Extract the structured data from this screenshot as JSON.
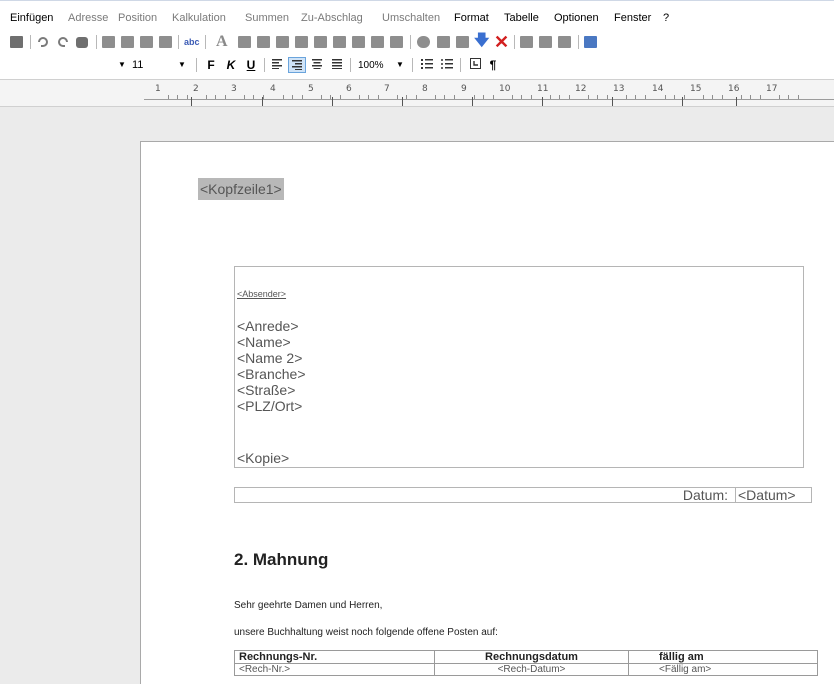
{
  "menu": [
    {
      "label": "Einfügen",
      "enabled": true
    },
    {
      "label": "Adresse",
      "enabled": false
    },
    {
      "label": "Position",
      "enabled": false
    },
    {
      "label": "Kalkulation",
      "enabled": false
    },
    {
      "label": "Summen",
      "enabled": false
    },
    {
      "label": "Zu-Abschlag",
      "enabled": false
    },
    {
      "label": "Umschalten",
      "enabled": false
    },
    {
      "label": "Format",
      "enabled": true
    },
    {
      "label": "Tabelle",
      "enabled": true
    },
    {
      "label": "Optionen",
      "enabled": true
    },
    {
      "label": "Fenster",
      "enabled": true
    },
    {
      "label": "?",
      "enabled": true
    }
  ],
  "toolbar": {
    "spell_check_label": "abc",
    "text_color_label": "A",
    "delete_label": "✕",
    "down_arrow_label": "🡇"
  },
  "format_bar": {
    "font_size": "11",
    "bold_label": "F",
    "italic_label": "K",
    "underline_label": "U",
    "zoom": "100%",
    "pilcrow_label": "¶"
  },
  "ruler": {
    "numbers": [
      "1",
      "2",
      "3",
      "4",
      "5",
      "6",
      "7",
      "8",
      "9",
      "10",
      "11",
      "12",
      "13",
      "14",
      "15",
      "16",
      "17"
    ]
  },
  "document": {
    "header_field": "<Kopfzeile1>",
    "sender_field": "<Absender>",
    "address_fields": [
      "<Anrede>",
      "<Name>",
      "<Name 2>",
      "<Branche>",
      "<Straße>",
      "<PLZ/Ort>"
    ],
    "copy_field": "<Kopie>",
    "date_label": "Datum:",
    "date_field": "<Datum>",
    "title": "2. Mahnung",
    "salutation": "Sehr geehrte Damen und Herren,",
    "intro": "unsere Buchhaltung weist noch folgende offene Posten auf:",
    "table": {
      "headers": [
        "Rechnungs-Nr.",
        "Rechnungsdatum",
        "fällig am"
      ],
      "rows": [
        [
          "<Rech-Nr.>",
          "<Rech-Datum>",
          "<Fällig am>"
        ]
      ]
    }
  },
  "colors": {
    "workspace": "#ebebeb",
    "header_field_bg": "#b8b8b8",
    "delete_icon": "#d21f1f",
    "arrow_icon": "#3a6fd0"
  }
}
